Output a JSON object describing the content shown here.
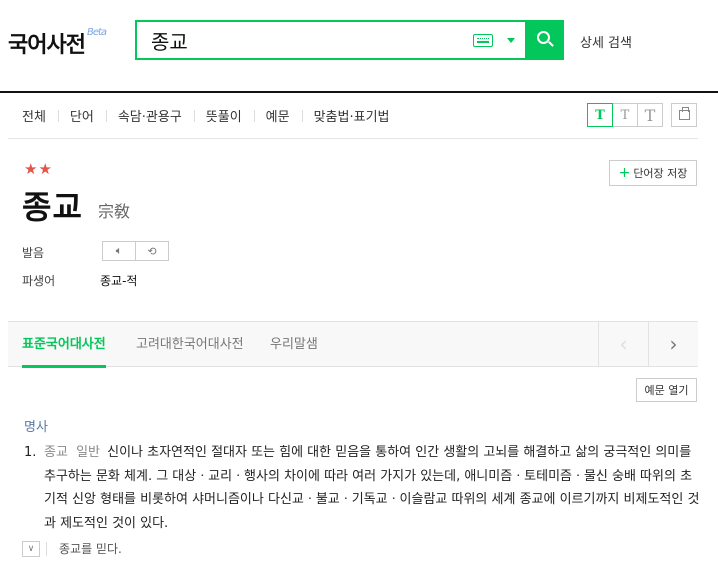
{
  "header": {
    "logo": "국어사전",
    "beta": "Beta",
    "search_value": "종교",
    "advanced_search": "상세 검색"
  },
  "filter_tabs": [
    "전체",
    "단어",
    "속담·관용구",
    "뜻풀이",
    "예문",
    "맞춤법·표기법"
  ],
  "font_tools": [
    "T",
    "T",
    "T"
  ],
  "entry": {
    "stars": "★★",
    "headword": "종교",
    "hanja": "宗敎",
    "wordbook_button": "단어장 저장",
    "pronunciation_label": "발음",
    "derivative_label": "파생어",
    "derivative_value": "종교-적"
  },
  "dict_tabs": [
    "표준국어대사전",
    "고려대한국어대사전",
    "우리말샘"
  ],
  "examples_button": "예문 열기",
  "definition": {
    "part_of_speech": "명사",
    "number": "1.",
    "tag_field": "종교",
    "tag_category": "일반",
    "text": "신이나 초자연적인 절대자 또는 힘에 대한 믿음을 통하여 인간 생활의 고뇌를 해결하고 삶의 궁극적인 의미를 추구하는 문화 체계. 그 대상ㆍ교리ㆍ행사의 차이에 따라 여러 가지가 있는데, 애니미즘ㆍ토테미즘ㆍ물신 숭배 따위의 초기적 신앙 형태를 비롯하여 샤머니즘이나 다신교ㆍ불교ㆍ기독교ㆍ이슬람교 따위의 세계 종교에 이르기까지 비제도적인 것과 제도적인 것이 있다.",
    "example": "종교를 믿다."
  },
  "colors": {
    "accent": "#03c75a",
    "star": "#e1554b",
    "pos": "#5a7aa8"
  }
}
